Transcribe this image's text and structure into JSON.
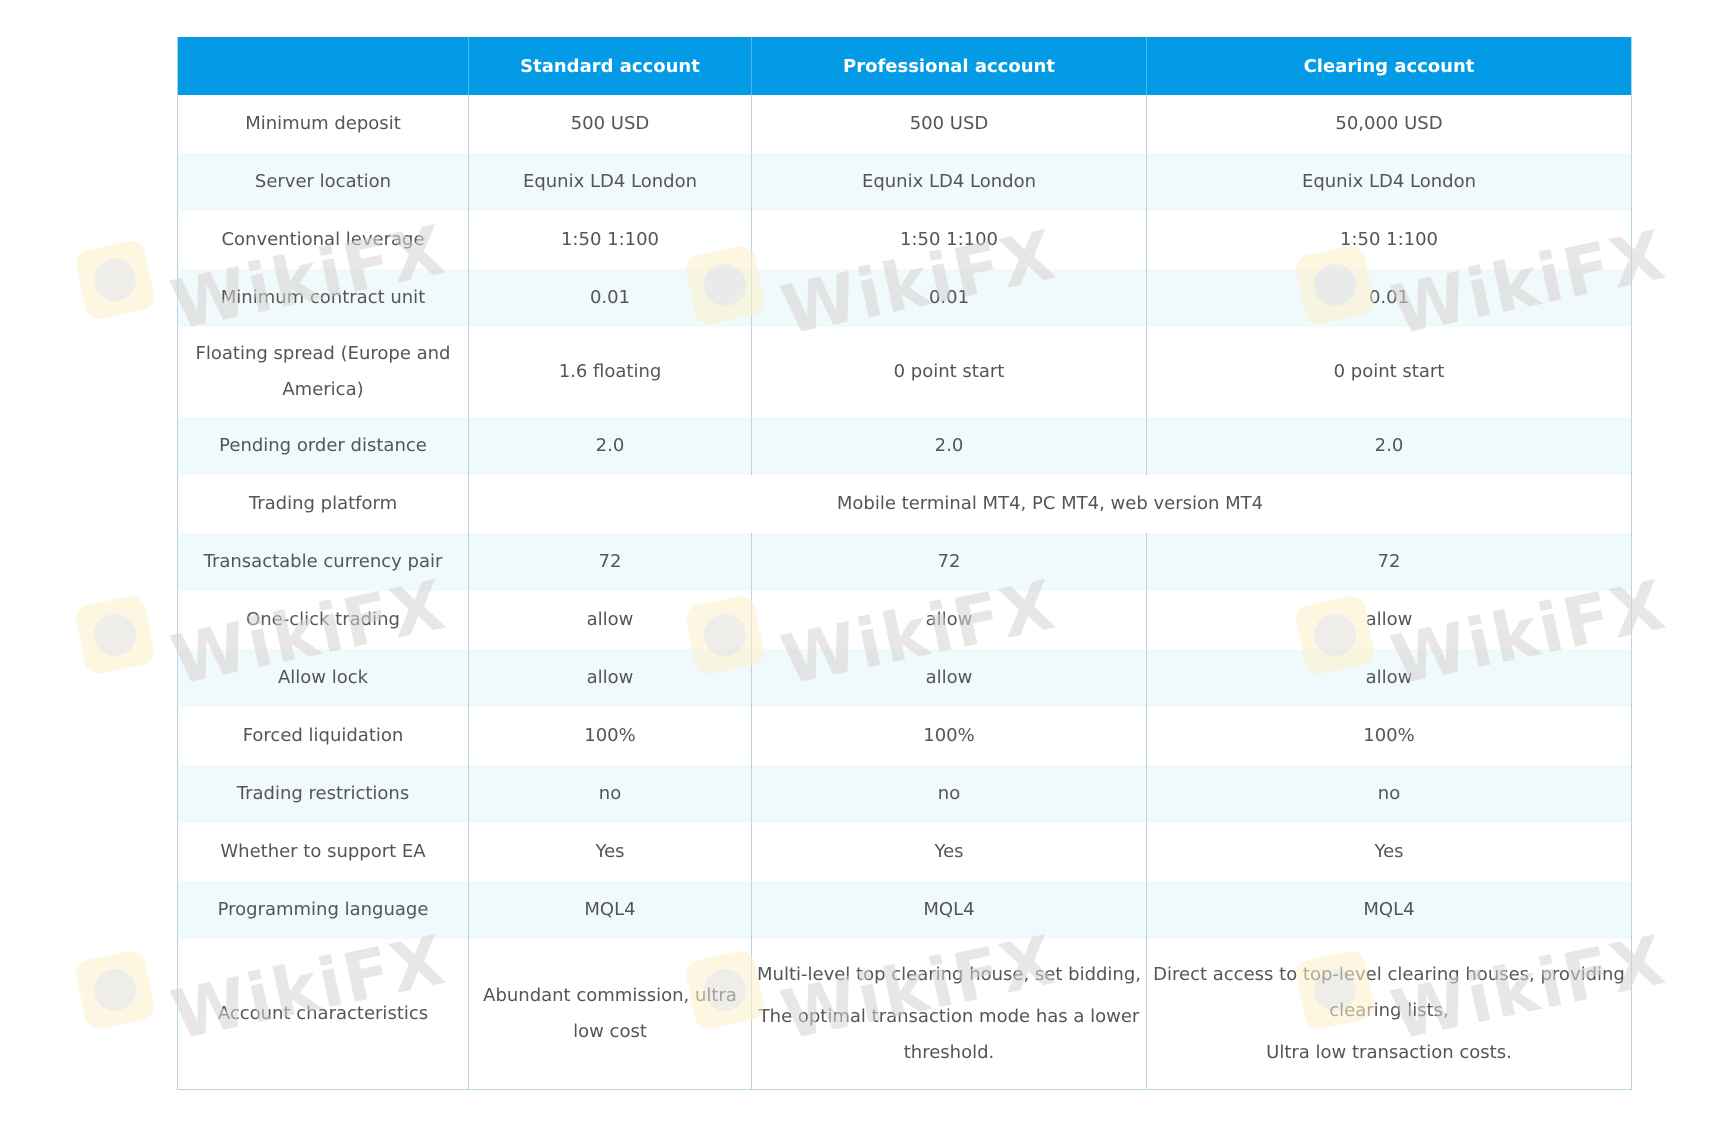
{
  "table": {
    "headers": [
      "",
      "Standard account",
      "Professional account",
      "Clearing account"
    ],
    "rows": [
      {
        "label": "Minimum deposit",
        "values": [
          "500 USD",
          "500 USD",
          "50,000 USD"
        ]
      },
      {
        "label": "Server location",
        "values": [
          "Equnix LD4 London",
          "Equnix LD4 London",
          "Equnix LD4 London"
        ]
      },
      {
        "label": "Conventional leverage",
        "values": [
          "1:50 1:100",
          "1:50 1:100",
          "1:50 1:100"
        ]
      },
      {
        "label": "Minimum contract unit",
        "values": [
          "0.01",
          "0.01",
          "0.01"
        ]
      },
      {
        "label": "Floating spread (Europe and America)",
        "values": [
          "1.6 floating",
          "0 point start",
          "0 point start"
        ]
      },
      {
        "label": "Pending order distance",
        "values": [
          "2.0",
          "2.0",
          "2.0"
        ]
      },
      {
        "label": "Trading platform",
        "merged_value": "Mobile terminal MT4, PC MT4, web version MT4"
      },
      {
        "label": "Transactable currency pair",
        "values": [
          "72",
          "72",
          "72"
        ]
      },
      {
        "label": "One-click trading",
        "values": [
          "allow",
          "allow",
          "allow"
        ]
      },
      {
        "label": "Allow lock",
        "values": [
          "allow",
          "allow",
          "allow"
        ]
      },
      {
        "label": "Forced liquidation",
        "values": [
          "100%",
          "100%",
          "100%"
        ]
      },
      {
        "label": "Trading restrictions",
        "values": [
          "no",
          "no",
          "no"
        ]
      },
      {
        "label": "Whether to support EA",
        "values": [
          "Yes",
          "Yes",
          "Yes"
        ]
      },
      {
        "label": "Programming language",
        "values": [
          "MQL4",
          "MQL4",
          "MQL4"
        ]
      },
      {
        "label": "Account characteristics",
        "values": [
          [
            "Abundant commission, ultra low cost"
          ],
          [
            "Multi-level top clearing house, set bidding,",
            "The optimal transaction mode has a lower threshold."
          ],
          [
            "Direct access to top-level clearing houses, providing clearing lists,",
            "Ultra low transaction costs."
          ]
        ]
      }
    ]
  },
  "watermark": {
    "text": "WikiFX",
    "icon": "wikifx-logo-icon"
  }
}
